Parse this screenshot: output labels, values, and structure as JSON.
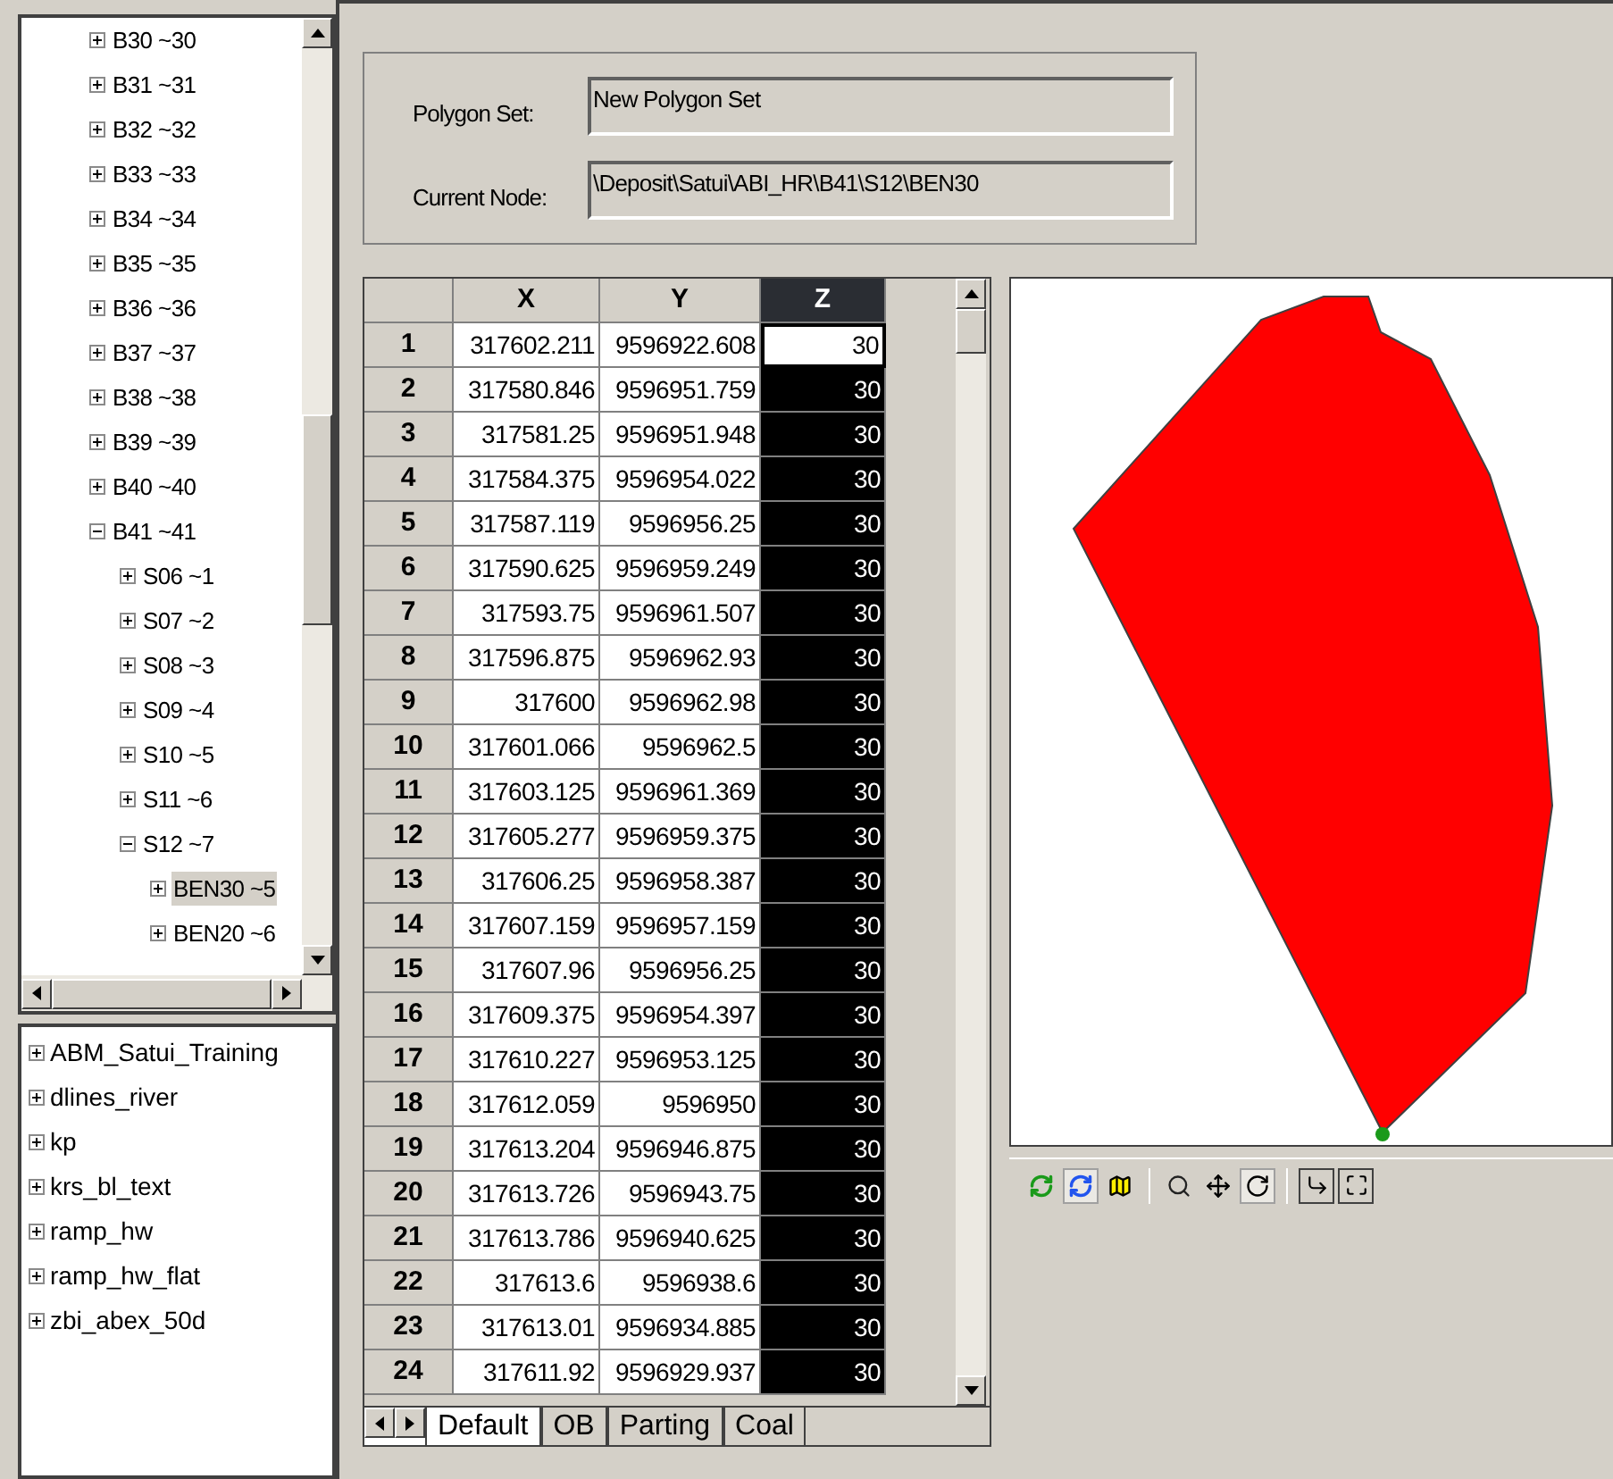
{
  "tree": {
    "items": [
      {
        "label": "B30 ~30",
        "expanded": false,
        "selected": false
      },
      {
        "label": "B31 ~31",
        "expanded": false,
        "selected": false
      },
      {
        "label": "B32 ~32",
        "expanded": false,
        "selected": false
      },
      {
        "label": "B33 ~33",
        "expanded": false,
        "selected": false
      },
      {
        "label": "B34 ~34",
        "expanded": false,
        "selected": false
      },
      {
        "label": "B35 ~35",
        "expanded": false,
        "selected": false
      },
      {
        "label": "B36 ~36",
        "expanded": false,
        "selected": false
      },
      {
        "label": "B37 ~37",
        "expanded": false,
        "selected": false
      },
      {
        "label": "B38 ~38",
        "expanded": false,
        "selected": false
      },
      {
        "label": "B39 ~39",
        "expanded": false,
        "selected": false
      },
      {
        "label": "B40 ~40",
        "expanded": false,
        "selected": false
      },
      {
        "label": "B41 ~41",
        "expanded": true,
        "selected": false,
        "children": [
          {
            "label": "S06 ~1",
            "expanded": false,
            "selected": false
          },
          {
            "label": "S07 ~2",
            "expanded": false,
            "selected": false
          },
          {
            "label": "S08 ~3",
            "expanded": false,
            "selected": false
          },
          {
            "label": "S09 ~4",
            "expanded": false,
            "selected": false
          },
          {
            "label": "S10 ~5",
            "expanded": false,
            "selected": false
          },
          {
            "label": "S11 ~6",
            "expanded": false,
            "selected": false
          },
          {
            "label": "S12 ~7",
            "expanded": true,
            "selected": false,
            "children": [
              {
                "label": "BEN30 ~5",
                "expanded": false,
                "selected": true
              },
              {
                "label": "BEN20 ~6",
                "expanded": false,
                "selected": false
              }
            ]
          }
        ]
      }
    ]
  },
  "layers": [
    {
      "label": "ABM_Satui_Training",
      "expanded": false
    },
    {
      "label": "dlines_river",
      "expanded": false
    },
    {
      "label": "kp",
      "expanded": false
    },
    {
      "label": "krs_bl_text",
      "expanded": false
    },
    {
      "label": "ramp_hw",
      "expanded": false
    },
    {
      "label": "ramp_hw_flat",
      "expanded": false
    },
    {
      "label": "zbi_abex_50d",
      "expanded": false
    }
  ],
  "form": {
    "polygon_set_label": "Polygon Set:",
    "polygon_set": "New Polygon Set",
    "current_node_label": "Current Node:",
    "current_node": "\\Deposit\\Satui\\ABI_HR\\B41\\S12\\BEN30"
  },
  "grid": {
    "columns": [
      {
        "label": "X",
        "selected": false
      },
      {
        "label": "Y",
        "selected": false
      },
      {
        "label": "Z",
        "selected": true
      }
    ],
    "rows": [
      {
        "n": "1",
        "cells": [
          "317602.211",
          "9596922.608",
          "30"
        ],
        "active": true
      },
      {
        "n": "2",
        "cells": [
          "317580.846",
          "9596951.759",
          "30"
        ],
        "active": false
      },
      {
        "n": "3",
        "cells": [
          "317581.25",
          "9596951.948",
          "30"
        ],
        "active": false
      },
      {
        "n": "4",
        "cells": [
          "317584.375",
          "9596954.022",
          "30"
        ],
        "active": false
      },
      {
        "n": "5",
        "cells": [
          "317587.119",
          "9596956.25",
          "30"
        ],
        "active": false
      },
      {
        "n": "6",
        "cells": [
          "317590.625",
          "9596959.249",
          "30"
        ],
        "active": false
      },
      {
        "n": "7",
        "cells": [
          "317593.75",
          "9596961.507",
          "30"
        ],
        "active": false
      },
      {
        "n": "8",
        "cells": [
          "317596.875",
          "9596962.93",
          "30"
        ],
        "active": false
      },
      {
        "n": "9",
        "cells": [
          "317600",
          "9596962.98",
          "30"
        ],
        "active": false
      },
      {
        "n": "10",
        "cells": [
          "317601.066",
          "9596962.5",
          "30"
        ],
        "active": false
      },
      {
        "n": "11",
        "cells": [
          "317603.125",
          "9596961.369",
          "30"
        ],
        "active": false
      },
      {
        "n": "12",
        "cells": [
          "317605.277",
          "9596959.375",
          "30"
        ],
        "active": false
      },
      {
        "n": "13",
        "cells": [
          "317606.25",
          "9596958.387",
          "30"
        ],
        "active": false
      },
      {
        "n": "14",
        "cells": [
          "317607.159",
          "9596957.159",
          "30"
        ],
        "active": false
      },
      {
        "n": "15",
        "cells": [
          "317607.96",
          "9596956.25",
          "30"
        ],
        "active": false
      },
      {
        "n": "16",
        "cells": [
          "317609.375",
          "9596954.397",
          "30"
        ],
        "active": false
      },
      {
        "n": "17",
        "cells": [
          "317610.227",
          "9596953.125",
          "30"
        ],
        "active": false
      },
      {
        "n": "18",
        "cells": [
          "317612.059",
          "9596950",
          "30"
        ],
        "active": false
      },
      {
        "n": "19",
        "cells": [
          "317613.204",
          "9596946.875",
          "30"
        ],
        "active": false
      },
      {
        "n": "20",
        "cells": [
          "317613.726",
          "9596943.75",
          "30"
        ],
        "active": false
      },
      {
        "n": "21",
        "cells": [
          "317613.786",
          "9596940.625",
          "30"
        ],
        "active": false
      },
      {
        "n": "22",
        "cells": [
          "317613.6",
          "9596938.6",
          "30"
        ],
        "active": false
      },
      {
        "n": "23",
        "cells": [
          "317613.01",
          "9596934.885",
          "30"
        ],
        "active": false
      },
      {
        "n": "24",
        "cells": [
          "317611.92",
          "9596929.937",
          "30"
        ],
        "active": false
      }
    ]
  },
  "sheet_tabs": [
    {
      "label": "Default",
      "selected": true
    },
    {
      "label": "OB",
      "selected": false
    },
    {
      "label": "Parting",
      "selected": false
    },
    {
      "label": "Coal",
      "selected": false
    }
  ],
  "toolbar": [
    {
      "kind": "refresh-green",
      "pressed": false
    },
    {
      "kind": "refresh-blue",
      "pressed": true
    },
    {
      "kind": "map",
      "pressed": false
    },
    {
      "kind": "sep"
    },
    {
      "kind": "zoom",
      "pressed": false
    },
    {
      "kind": "pan",
      "pressed": false
    },
    {
      "kind": "rotate",
      "pressed": true
    },
    {
      "kind": "sep"
    },
    {
      "kind": "axes",
      "pressed": false
    },
    {
      "kind": "fit",
      "pressed": false
    }
  ]
}
